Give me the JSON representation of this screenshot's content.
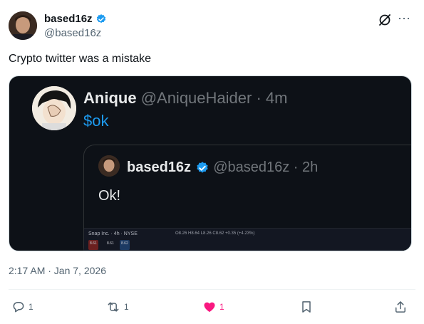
{
  "author": {
    "name": "based16z",
    "handle": "@based16z"
  },
  "tweet": {
    "text": "Crypto twitter was a mistake",
    "timestamp": "2:17 AM · Jan 7, 2026"
  },
  "quoted": {
    "name": "Anique",
    "handle": "@AniqueHaider",
    "time": "· 4m",
    "text": "$ok",
    "inner": {
      "name": "based16z",
      "handle": "@based16z",
      "time": "· 2h",
      "text": "Ok!",
      "chart": {
        "ticker": "Snap Inc. · 4h · NYSE",
        "ohlc": "O8.26 H8.64 L8.26 C8.62 +0.35 (+4.23%)",
        "box1": "8.61",
        "box2": "8.61",
        "box3": "8.62"
      }
    }
  },
  "actions": {
    "replies": "1",
    "reposts": "1",
    "likes": "1"
  },
  "colors": {
    "accent": "#1d9bf0",
    "like": "#f91880",
    "verified": "#1d9bf0"
  },
  "icons": {
    "reply": "speech-bubble-icon",
    "repost": "repost-arrows-icon",
    "like": "heart-icon",
    "bookmark": "bookmark-icon",
    "share": "share-icon"
  }
}
